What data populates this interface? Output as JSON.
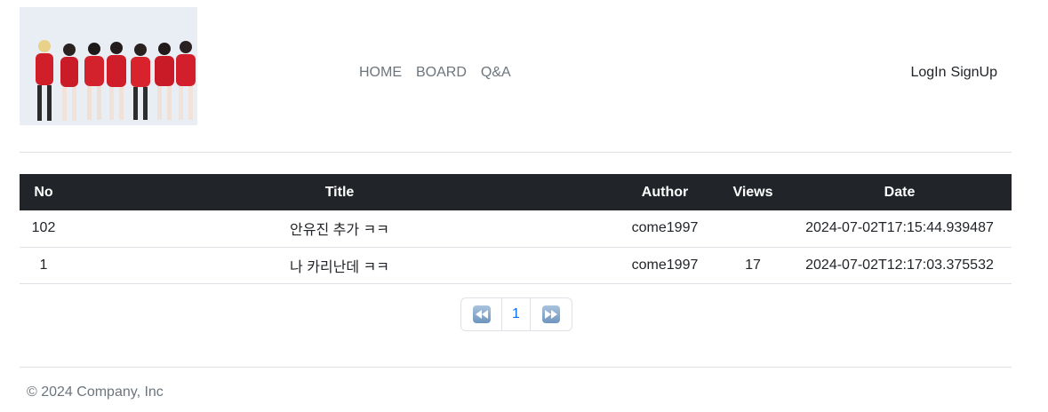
{
  "header": {
    "logo_alt": "group photo",
    "nav": [
      "HOME",
      "BOARD",
      "Q&A"
    ],
    "login_label": "LogIn",
    "signup_label": "SignUp"
  },
  "table": {
    "columns": [
      "No",
      "Title",
      "Author",
      "Views",
      "Date"
    ],
    "rows": [
      {
        "no": "102",
        "title": "안유진 추가 ㅋㅋ",
        "author": "come1997",
        "views": "",
        "date": "2024-07-02T17:15:44.939487"
      },
      {
        "no": "1",
        "title": "나 카리난데 ㅋㅋ",
        "author": "come1997",
        "views": "17",
        "date": "2024-07-02T12:17:03.375532"
      }
    ]
  },
  "pagination": {
    "first_icon": "double-left-arrow-icon",
    "page": "1",
    "last_icon": "double-right-arrow-icon"
  },
  "footer": {
    "text": "© 2024 Company, Inc"
  }
}
